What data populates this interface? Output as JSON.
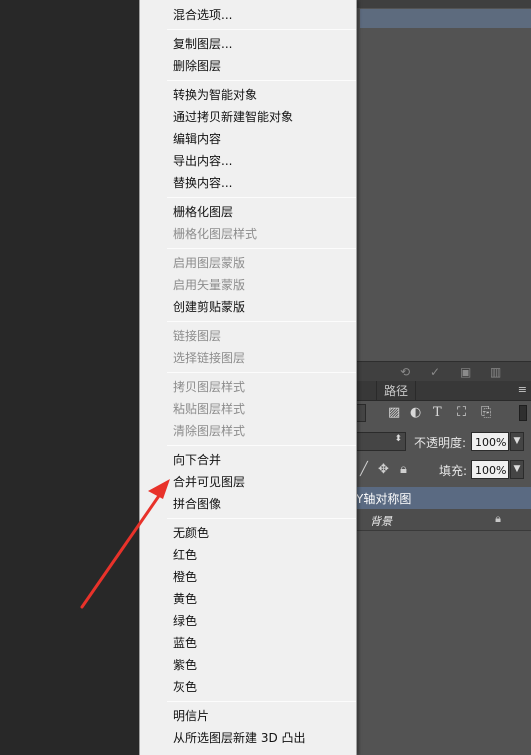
{
  "menu": {
    "items": [
      {
        "label": "混合选项...",
        "enabled": true
      },
      {
        "label": "复制图层...",
        "enabled": true
      },
      {
        "label": "删除图层",
        "enabled": true
      },
      {
        "label": "转换为智能对象",
        "enabled": true
      },
      {
        "label": "通过拷贝新建智能对象",
        "enabled": true
      },
      {
        "label": "编辑内容",
        "enabled": true
      },
      {
        "label": "导出内容...",
        "enabled": true
      },
      {
        "label": "替换内容...",
        "enabled": true
      },
      {
        "label": "栅格化图层",
        "enabled": true
      },
      {
        "label": "栅格化图层样式",
        "enabled": false
      },
      {
        "label": "启用图层蒙版",
        "enabled": false
      },
      {
        "label": "启用矢量蒙版",
        "enabled": false
      },
      {
        "label": "创建剪贴蒙版",
        "enabled": true
      },
      {
        "label": "链接图层",
        "enabled": false
      },
      {
        "label": "选择链接图层",
        "enabled": false
      },
      {
        "label": "拷贝图层样式",
        "enabled": false
      },
      {
        "label": "粘贴图层样式",
        "enabled": false
      },
      {
        "label": "清除图层样式",
        "enabled": false
      },
      {
        "label": "向下合并",
        "enabled": true
      },
      {
        "label": "合并可见图层",
        "enabled": true
      },
      {
        "label": "拼合图像",
        "enabled": true
      },
      {
        "label": "无颜色",
        "enabled": true
      },
      {
        "label": "红色",
        "enabled": true
      },
      {
        "label": "橙色",
        "enabled": true
      },
      {
        "label": "黄色",
        "enabled": true
      },
      {
        "label": "绿色",
        "enabled": true
      },
      {
        "label": "蓝色",
        "enabled": true
      },
      {
        "label": "紫色",
        "enabled": true
      },
      {
        "label": "灰色",
        "enabled": true
      },
      {
        "label": "明信片",
        "enabled": true
      },
      {
        "label": "从所选图层新建 3D 凸出",
        "enabled": true
      }
    ]
  },
  "panel": {
    "paths_tab": "路径",
    "opacity_label": "不透明度:",
    "opacity_value": "100%",
    "fill_label": "填充:",
    "fill_value": "100%",
    "selected_layer_name": "Y轴对称图",
    "background_layer_name": "背景"
  },
  "colors": {
    "annotation_arrow": "#e8322a",
    "menu_bg": "#f0f0f0",
    "selected_layer": "#5a6a82"
  }
}
